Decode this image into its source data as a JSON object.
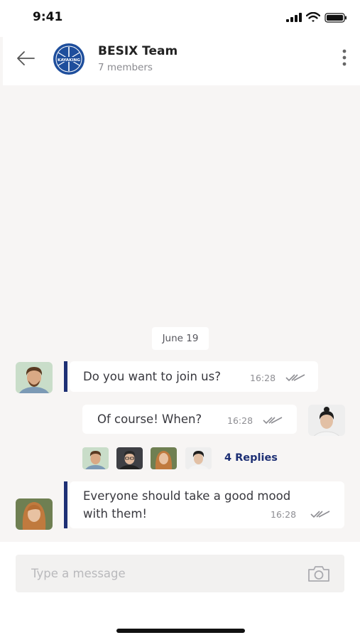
{
  "status_bar": {
    "time": "9:41"
  },
  "header": {
    "group_name": "BESIX Team",
    "member_count": "7 members",
    "avatar_text": "KAYAKING"
  },
  "chat": {
    "date_label": "June 19",
    "messages": [
      {
        "text": "Do you want to join us?",
        "time": "16:28",
        "direction": "incoming"
      },
      {
        "text": "Of course! When?",
        "time": "16:28",
        "direction": "outgoing"
      },
      {
        "text_line1": "Everyone should take a good mood",
        "text_line2": "with them!",
        "time": "16:28",
        "direction": "incoming"
      }
    ],
    "replies_label": "4 Replies"
  },
  "composer": {
    "placeholder": "Type a message"
  },
  "colors": {
    "accent": "#1d2f74",
    "background": "#f7f5f4",
    "bubble": "#ffffff",
    "text": "#38383e",
    "muted": "#8e8e93"
  },
  "icons": [
    "back-arrow-icon",
    "more-vertical-icon",
    "double-check-icon",
    "camera-icon",
    "signal-icon",
    "wifi-icon",
    "battery-icon"
  ]
}
